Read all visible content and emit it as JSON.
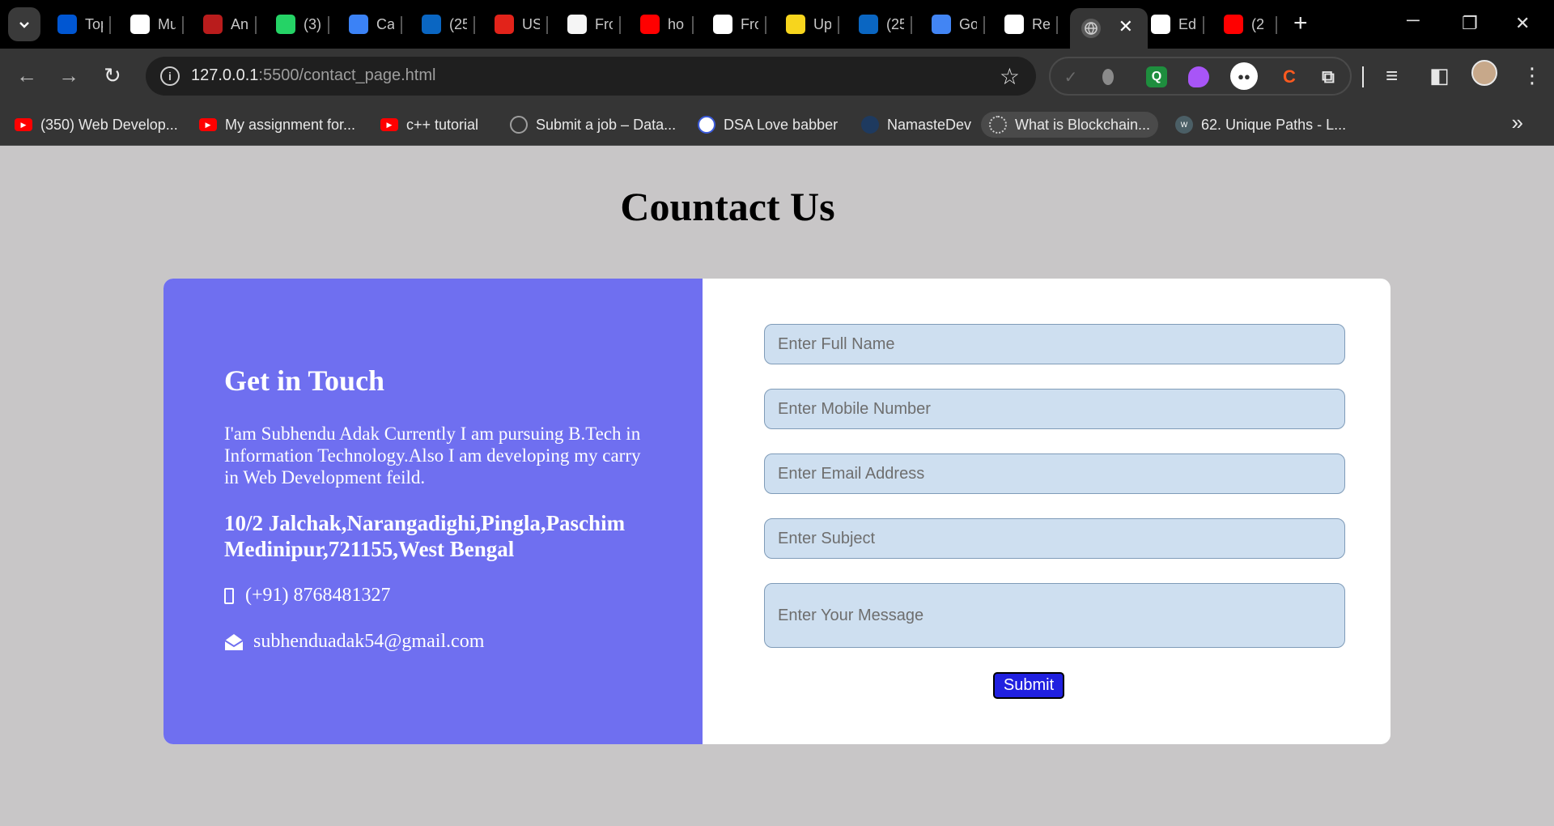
{
  "browser": {
    "tabs": [
      {
        "title": "Top",
        "icon": "coursera-icon",
        "color": "#0056d2"
      },
      {
        "title": "Mu",
        "icon": "medium-icon",
        "color": "#ffffff"
      },
      {
        "title": "An",
        "icon": "anaconda-icon",
        "color": "#b91c1c"
      },
      {
        "title": "(3)",
        "icon": "whatsapp-icon",
        "color": "#25d366"
      },
      {
        "title": "Ca",
        "icon": "cartesi-icon",
        "color": "#3b82f6"
      },
      {
        "title": "(25",
        "icon": "linkedin-icon",
        "color": "#0a66c2"
      },
      {
        "title": "US",
        "icon": "oracle-icon",
        "color": "#e2231a"
      },
      {
        "title": "Fro",
        "icon": "shine-icon",
        "color": "#f5f5f5"
      },
      {
        "title": "ho",
        "icon": "youtube-icon",
        "color": "#ff0000"
      },
      {
        "title": "Fro",
        "icon": "google-icon",
        "color": "#ffffff"
      },
      {
        "title": "Up",
        "icon": "upgrad-icon",
        "color": "#f7d51d"
      },
      {
        "title": "(25",
        "icon": "linkedin-icon",
        "color": "#0a66c2"
      },
      {
        "title": "Go",
        "icon": "google-translate-icon",
        "color": "#4285f4"
      },
      {
        "title": "Re",
        "icon": "google-icon",
        "color": "#ffffff"
      }
    ],
    "tabs_after": [
      {
        "title": "Ed",
        "icon": "github-icon",
        "color": "#ffffff"
      },
      {
        "title": "(2",
        "icon": "youtube-icon",
        "color": "#ff0000"
      }
    ],
    "active_tab_close": "✕",
    "new_tab": "+",
    "url_host": "127.0.0.1",
    "url_path": ":5500/contact_page.html",
    "bookmarks": [
      {
        "label": "(350) Web Develop...",
        "icon": "youtube-icon"
      },
      {
        "label": "My assignment for...",
        "icon": "youtube-icon"
      },
      {
        "label": "c++ tutorial",
        "icon": "youtube-icon"
      },
      {
        "label": "Submit a job – Data...",
        "icon": "gear-icon"
      },
      {
        "label": "DSA Love babber",
        "icon": "globe-icon"
      },
      {
        "label": "NamasteDev",
        "icon": "namastedev-icon"
      },
      {
        "label": "What is Blockchain...",
        "icon": "blockchain-icon"
      },
      {
        "label": "62. Unique Paths - L...",
        "icon": "wiki-icon"
      }
    ]
  },
  "page": {
    "title": "Countact Us",
    "info": {
      "heading": "Get in Touch",
      "about": "I'am Subhendu Adak Currently I am pursuing B.Tech in Information Technology.Also I am developing my carry in Web Development feild.",
      "address": "10/2 Jalchak,Narangadighi,Pingla,Paschim Medinipur,721155,West Bengal",
      "phone": "(+91) 8768481327",
      "email": "subhenduadak54@gmail.com"
    },
    "form": {
      "name_placeholder": "Enter Full Name",
      "mobile_placeholder": "Enter Mobile Number",
      "email_placeholder": "Enter Email Address",
      "subject_placeholder": "Enter Subject",
      "message_placeholder": "Enter Your Message",
      "submit_label": "Submit"
    }
  },
  "colors": {
    "page_bg": "#c8c6c7",
    "info_panel_bg": "#6f6ff0",
    "field_bg": "#cedff0",
    "submit_bg": "#2020e0"
  }
}
